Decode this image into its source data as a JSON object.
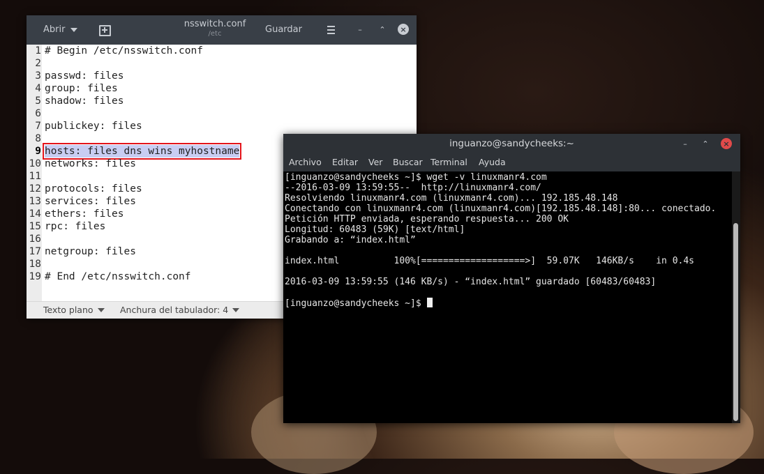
{
  "editor": {
    "open_label": "Abrir",
    "filename": "nsswitch.conf",
    "folder": "/etc",
    "save_label": "Guardar",
    "lines": [
      {
        "n": "1",
        "text": "# Begin /etc/nsswitch.conf"
      },
      {
        "n": "2",
        "text": ""
      },
      {
        "n": "3",
        "text": "passwd: files"
      },
      {
        "n": "4",
        "text": "group: files"
      },
      {
        "n": "5",
        "text": "shadow: files"
      },
      {
        "n": "6",
        "text": ""
      },
      {
        "n": "7",
        "text": "publickey: files"
      },
      {
        "n": "8",
        "text": ""
      },
      {
        "n": "9",
        "text": "hosts: files dns wins myhostname"
      },
      {
        "n": "10",
        "text": "networks: files"
      },
      {
        "n": "11",
        "text": ""
      },
      {
        "n": "12",
        "text": "protocols: files"
      },
      {
        "n": "13",
        "text": "services: files"
      },
      {
        "n": "14",
        "text": "ethers: files"
      },
      {
        "n": "15",
        "text": "rpc: files"
      },
      {
        "n": "16",
        "text": ""
      },
      {
        "n": "17",
        "text": "netgroup: files"
      },
      {
        "n": "18",
        "text": ""
      },
      {
        "n": "19",
        "text": "# End /etc/nsswitch.conf"
      }
    ],
    "status_syntax": "Texto plano",
    "status_tab": "Anchura del tabulador: 4"
  },
  "terminal": {
    "title": "inguanzo@sandycheeks:~",
    "menu": [
      "Archivo",
      "Editar",
      "Ver",
      "Buscar",
      "Terminal",
      "Ayuda"
    ],
    "lines": [
      "[inguanzo@sandycheeks ~]$ wget -v linuxmanr4.com",
      "--2016-03-09 13:59:55--  http://linuxmanr4.com/",
      "Resolviendo linuxmanr4.com (linuxmanr4.com)... 192.185.48.148",
      "Conectando con linuxmanr4.com (linuxmanr4.com)[192.185.48.148]:80... conectado.",
      "Petición HTTP enviada, esperando respuesta... 200 OK",
      "Longitud: 60483 (59K) [text/html]",
      "Grabando a: “index.html”",
      "",
      "index.html          100%[===================>]  59.07K   146KB/s    in 0.4s",
      "",
      "2016-03-09 13:59:55 (146 KB/s) - “index.html” guardado [60483/60483]",
      "",
      "[inguanzo@sandycheeks ~]$ "
    ]
  },
  "colors": {
    "highlight_box": "#e3141b",
    "selection": "#c8cdf2",
    "titlebar": "#393f47",
    "terminal_bg": "#000000"
  }
}
